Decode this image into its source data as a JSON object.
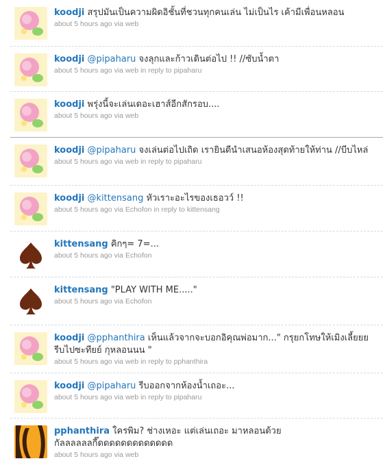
{
  "tweets": [
    {
      "user": "koodji",
      "mention": "",
      "text": "สรุปมันเป็นความผิดอิชั้นที่ชวนทุกคนเล่น ไม่เป็นไร เค้ามีเพื่อนหลอน",
      "time": "about 5 hours ago",
      "via": "via",
      "source": "web",
      "reply": "",
      "reply_to": "",
      "avatar": "koodji-avatar"
    },
    {
      "user": "koodji",
      "mention": "@pipaharu",
      "text": " จงลุกและก้าวเดินต่อไป !! //ซับน้ำตา",
      "time": "about 5 hours ago",
      "via": "via",
      "source": "web",
      "reply": "in reply to",
      "reply_to": "pipaharu",
      "avatar": "koodji-avatar"
    },
    {
      "user": "koodji",
      "mention": "",
      "text": "พรุ่งนี้จะเล่นเดอะเฮาส์อีกสักรอบ....",
      "time": "about 5 hours ago",
      "via": "via",
      "source": "web",
      "reply": "",
      "reply_to": "",
      "avatar": "koodji-avatar"
    },
    {
      "user": "koodji",
      "mention": "@pipaharu",
      "text": " จงเล่นต่อไปเถิด เรายินดีนำเสนอห้องสุดท้ายให้ท่าน //บีบไหล่",
      "time": "about 5 hours ago",
      "via": "via",
      "source": "web",
      "reply": "in reply to",
      "reply_to": "pipaharu",
      "avatar": "koodji-avatar"
    },
    {
      "user": "koodji",
      "mention": "@kittensang",
      "text": " หัวเราะอะไรของเธอวว์ !!",
      "time": "about 5 hours ago",
      "via": "via",
      "source": "Echofon",
      "reply": "in reply to",
      "reply_to": "kittensang",
      "avatar": "koodji-avatar"
    },
    {
      "user": "kittensang",
      "mention": "",
      "text": "คิกๆ= 7=...",
      "time": "about 5 hours ago",
      "via": "via",
      "source": "Echofon",
      "reply": "",
      "reply_to": "",
      "avatar": "spade-avatar"
    },
    {
      "user": "kittensang",
      "mention": "",
      "text": "\"PLAY WITH ME.....\"",
      "time": "about 5 hours ago",
      "via": "via",
      "source": "Echofon",
      "reply": "",
      "reply_to": "",
      "avatar": "spade-avatar"
    },
    {
      "user": "koodji",
      "mention": "@pphanthira",
      "text": " เห็นแล้วจากจะบอกอิคุณพ่อมาก...\" กรุยกโทษให้เมิงเลี้ยยย รีบไปซะทียย์ กุหลอนนน \"",
      "time": "about 5 hours ago",
      "via": "via",
      "source": "web",
      "reply": "in reply to",
      "reply_to": "pphanthira",
      "avatar": "koodji-avatar"
    },
    {
      "user": "koodji",
      "mention": "@pipaharu",
      "text": " รีบออกจากห้องน้ำเถอะ...",
      "time": "about 5 hours ago",
      "via": "via",
      "source": "web",
      "reply": "in reply to",
      "reply_to": "pipaharu",
      "avatar": "koodji-avatar"
    },
    {
      "user": "pphanthira",
      "mention": "",
      "text": "ใครพิม? ช่างเหอะ แต่เล่นเถอะ มาหลอนด้วยกัลลลลลลกี๊ดดดดดดดดดดดดด",
      "time": "about 5 hours ago",
      "via": "via",
      "source": "web",
      "reply": "",
      "reply_to": "",
      "avatar": "pphanthira-avatar"
    }
  ]
}
